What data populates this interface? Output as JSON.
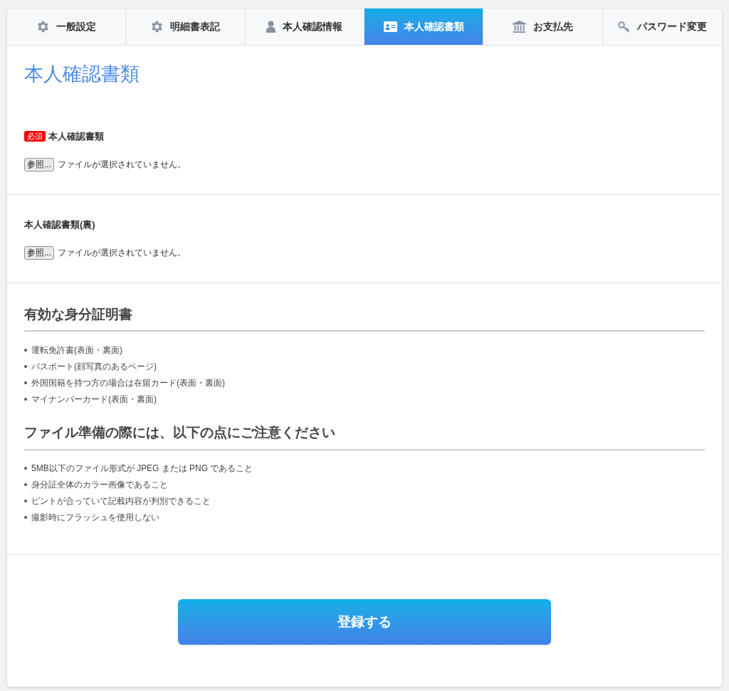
{
  "tabs": [
    {
      "label": "一般設定",
      "selected": false
    },
    {
      "label": "明細書表記",
      "selected": false
    },
    {
      "label": "本人確認情報",
      "selected": false
    },
    {
      "label": "本人確認書類",
      "selected": true
    },
    {
      "label": "お支払先",
      "selected": false
    },
    {
      "label": "パスワード変更",
      "selected": false
    }
  ],
  "page_title": "本人確認書類",
  "uploads": [
    {
      "required_badge": "必須",
      "label": "本人確認書類",
      "button": "参照...",
      "status": "ファイルが選択されていません。"
    },
    {
      "label": "本人確認書類(裏)",
      "button": "参照...",
      "status": "ファイルが選択されていません。"
    }
  ],
  "notes": [
    {
      "heading": "有効な身分証明書",
      "items": [
        "運転免許書(表面・裏面)",
        "パスポート(顔写真のあるページ)",
        "外国国籍を持つ方の場合は在留カード(表面・裏面)",
        "マイナンバーカード(表面・裏面)"
      ]
    },
    {
      "heading": "ファイル準備の際には、以下の点にご注意ください",
      "items": [
        "5MB以下のファイル形式が JPEG または PNG であること",
        "身分証全体のカラー画像であること",
        "ピントが合っていて記載内容が判別できること",
        "撮影時にフラッシュを使用しない"
      ]
    }
  ],
  "submit_button": "登録する"
}
